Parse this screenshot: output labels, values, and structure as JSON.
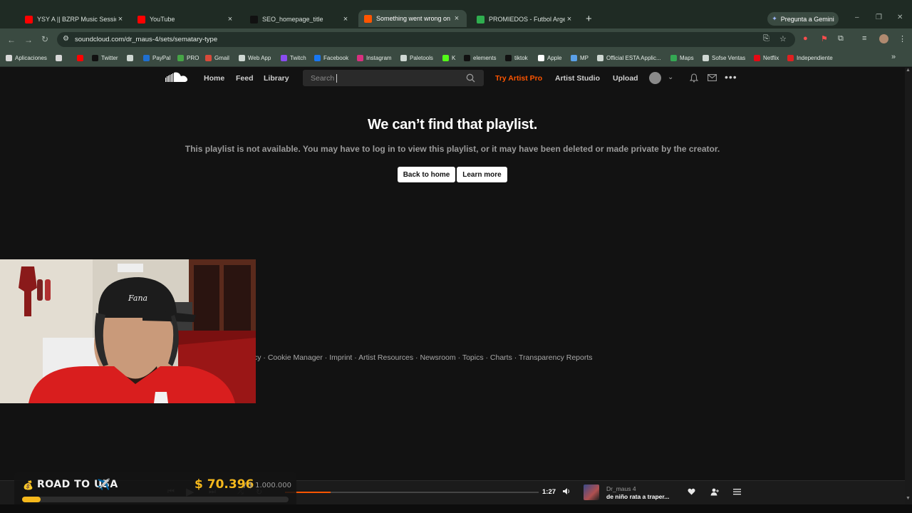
{
  "browser": {
    "tabs": [
      {
        "title": "YSY A || BZRP Music Sessions #",
        "favicon": "youtube-icon",
        "color": "#ff0000"
      },
      {
        "title": "YouTube",
        "favicon": "youtube-icon",
        "color": "#ff0000"
      },
      {
        "title": "SEO_homepage_title",
        "favicon": "tiktok-icon",
        "color": "#111111"
      },
      {
        "title": "Something went wrong on Sou",
        "favicon": "soundcloud-icon",
        "color": "#ff5500",
        "active": true
      },
      {
        "title": "PROMIEDOS - Futbol Argentino",
        "favicon": "promiedos-icon",
        "color": "#2fae4f"
      }
    ],
    "gemini_label": "Pregunta a Gemini",
    "url": "soundcloud.com/dr_maus-4/sets/sematary-type",
    "bookmarks": [
      {
        "label": "Aplicaciones",
        "color": "#d8d8d8"
      },
      {
        "label": "",
        "color": "#d8d8d8"
      },
      {
        "label": "",
        "color": "#ff0000"
      },
      {
        "label": "Twitter",
        "color": "#111111"
      },
      {
        "label": "",
        "color": "#cfd8d3"
      },
      {
        "label": "PayPal",
        "color": "#1f6fd1"
      },
      {
        "label": "PRO",
        "color": "#46a546"
      },
      {
        "label": "Gmail",
        "color": "#d94a3a"
      },
      {
        "label": "Web App",
        "color": "#cfd8d3"
      },
      {
        "label": "Twitch",
        "color": "#8a4cf0"
      },
      {
        "label": "Facebook",
        "color": "#1877f2"
      },
      {
        "label": "Instagram",
        "color": "#d9307f"
      },
      {
        "label": "Paletools",
        "color": "#cfd8d3"
      },
      {
        "label": "K",
        "color": "#53fc18"
      },
      {
        "label": "elements",
        "color": "#111111"
      },
      {
        "label": "tiktok",
        "color": "#111111"
      },
      {
        "label": "Apple",
        "color": "#ffffff"
      },
      {
        "label": "MP",
        "color": "#5aa0e8"
      },
      {
        "label": "Official ESTA Applic...",
        "color": "#cfd8d3"
      },
      {
        "label": "Maps",
        "color": "#34a853"
      },
      {
        "label": "Sofse Ventas",
        "color": "#cfd8d3"
      },
      {
        "label": "Netflix",
        "color": "#e50914"
      },
      {
        "label": "Independiente",
        "color": "#e02020"
      }
    ]
  },
  "soundcloud": {
    "nav": {
      "home": "Home",
      "feed": "Feed",
      "library": "Library"
    },
    "search_placeholder": "Search",
    "try_pro": "Try Artist Pro",
    "artist_studio": "Artist Studio",
    "upload": "Upload",
    "accent": "#ff5500"
  },
  "error": {
    "title": "We can’t find that playlist.",
    "subtitle": "This playlist is not available. You may have to log in to view this playlist, or it may have been deleted or made private by the creator.",
    "back_button": "Back to home",
    "learn_button": "Learn more"
  },
  "footer": {
    "links": [
      "cy",
      "Cookie Manager",
      "Imprint",
      "Artist Resources",
      "Newsroom",
      "Topics",
      "Charts",
      "Transparency Reports"
    ]
  },
  "player": {
    "time_total": "1:27",
    "progress": 0.18,
    "artist": "Dr_maus 4",
    "track": "de niño rata a traper..."
  },
  "overlay": {
    "title": "ROAD TO USA",
    "amount": "$ 70.396",
    "goal": "/ $ 1.000.000",
    "progress": 0.07,
    "accent": "#f5b81c"
  }
}
